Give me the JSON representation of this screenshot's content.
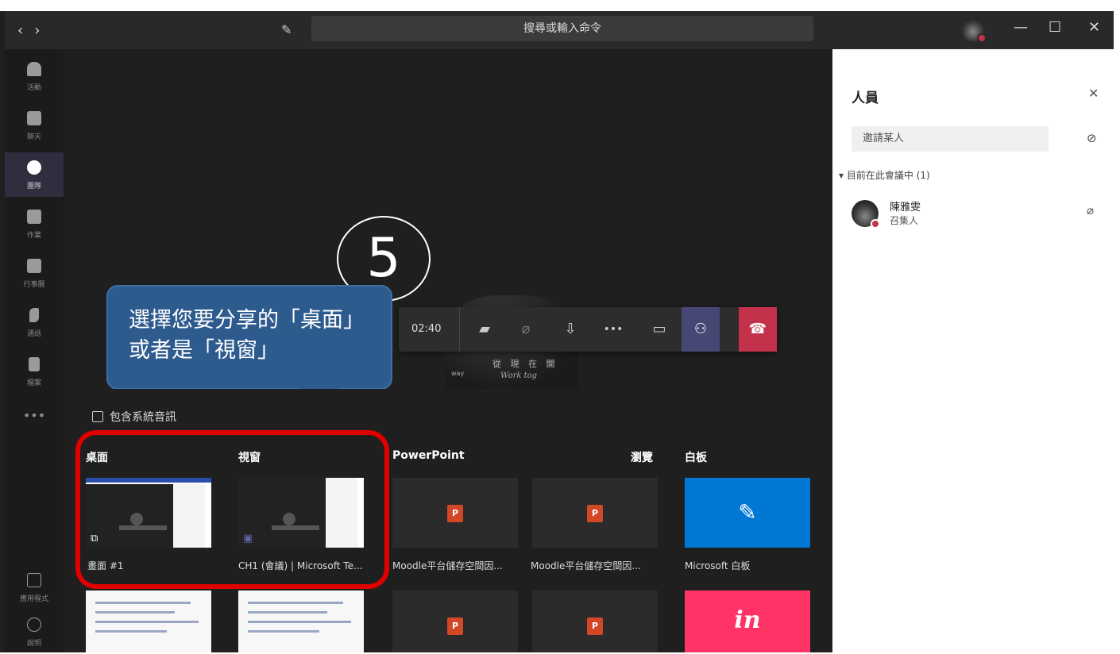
{
  "titlebar": {
    "back_arrow": "‹",
    "forward_arrow": "›",
    "compose_icon": "✎",
    "search_placeholder": "搜尋或輸入命令",
    "minimize": "—",
    "maximize": "☐",
    "close": "✕"
  },
  "rail": {
    "items": [
      {
        "label": "活動",
        "icon": "bell-icon"
      },
      {
        "label": "聊天",
        "icon": "chat-icon"
      },
      {
        "label": "團隊",
        "icon": "teams-icon"
      },
      {
        "label": "作業",
        "icon": "assignments-icon"
      },
      {
        "label": "行事曆",
        "icon": "calendar-icon"
      },
      {
        "label": "通話",
        "icon": "phone-icon"
      },
      {
        "label": "檔案",
        "icon": "file-icon"
      }
    ],
    "more": "•••",
    "apps_label": "應用程式",
    "help_label": "說明"
  },
  "video": {
    "text1": "從 現 在 開",
    "text2": "Work tog",
    "text3": "way"
  },
  "controls": {
    "timer": "02:40",
    "more_dots": "•••"
  },
  "annotation": {
    "step_number": "5",
    "callout_text": "選擇您要分享的「桌面」或者是「視窗」"
  },
  "share_tray": {
    "include_audio_label": "包含系統音訊",
    "sections": {
      "desktop": "桌面",
      "window": "視窗",
      "powerpoint": "PowerPoint",
      "browse": "瀏覽",
      "whiteboard": "白板"
    },
    "tiles": [
      {
        "label": "畫面 #1"
      },
      {
        "label": "CH1 (會議) | Microsoft Te..."
      },
      {
        "label": "Moodle平台儲存空間因..."
      },
      {
        "label": "Moodle平台儲存空間因..."
      },
      {
        "label": "Microsoft 白板"
      }
    ],
    "invision_glyph": "in"
  },
  "people_panel": {
    "title": "人員",
    "invite_placeholder": "邀請某人",
    "section_label": "目前在此會議中 (1)",
    "participants": [
      {
        "name": "陳雅雯",
        "role": "召集人"
      }
    ]
  },
  "colors": {
    "accent": "#464775",
    "hangup": "#c4314b",
    "callout": "#2e5b8e",
    "highlight": "#e00000",
    "whiteboard": "#0078d4",
    "invision": "#ff3366"
  }
}
